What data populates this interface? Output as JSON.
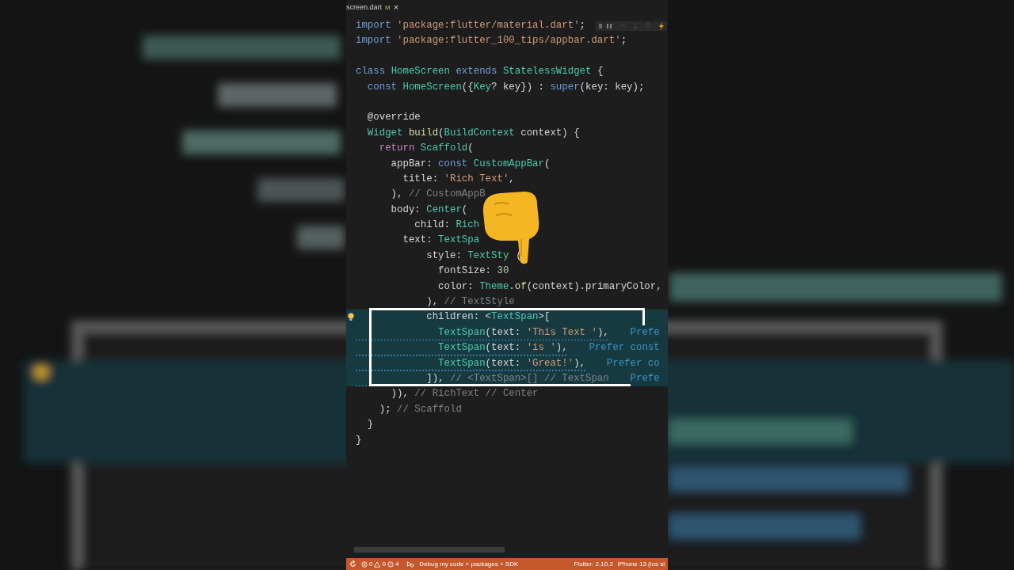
{
  "editor": {
    "tab": {
      "filename": "screen.dart",
      "badge": "M",
      "close": "×"
    },
    "lines": [
      {
        "kind": "code",
        "highlighted": false,
        "warning": false,
        "lightbulb": false,
        "tokens": [
          {
            "text": "import ",
            "kind": "kw"
          },
          {
            "text": "'package:flutter/material.dart'",
            "kind": "str"
          },
          {
            "text": ";",
            "kind": "plain"
          }
        ]
      },
      {
        "kind": "code",
        "highlighted": false,
        "warning": false,
        "lightbulb": false,
        "tokens": [
          {
            "text": "import ",
            "kind": "kw"
          },
          {
            "text": "'package:flutter_100_tips/appbar.dart'",
            "kind": "str"
          },
          {
            "text": ";",
            "kind": "plain"
          }
        ]
      },
      {
        "kind": "blank",
        "highlighted": false
      },
      {
        "kind": "code",
        "highlighted": false,
        "warning": false,
        "lightbulb": false,
        "tokens": [
          {
            "text": "class ",
            "kind": "kw"
          },
          {
            "text": "HomeScreen",
            "kind": "type"
          },
          {
            "text": " extends ",
            "kind": "kw"
          },
          {
            "text": "StatelessWidget",
            "kind": "type"
          },
          {
            "text": " {",
            "kind": "plain"
          }
        ]
      },
      {
        "kind": "code",
        "highlighted": false,
        "warning": false,
        "lightbulb": false,
        "tokens": [
          {
            "text": "  const ",
            "kind": "kw"
          },
          {
            "text": "HomeScreen",
            "kind": "type"
          },
          {
            "text": "({",
            "kind": "plain"
          },
          {
            "text": "Key",
            "kind": "type"
          },
          {
            "text": "? key}) : ",
            "kind": "plain"
          },
          {
            "text": "super",
            "kind": "kw"
          },
          {
            "text": "(key: key);",
            "kind": "plain"
          }
        ]
      },
      {
        "kind": "blank",
        "highlighted": false
      },
      {
        "kind": "code",
        "highlighted": false,
        "warning": false,
        "lightbulb": false,
        "tokens": [
          {
            "text": "  @override",
            "kind": "plain"
          }
        ]
      },
      {
        "kind": "code",
        "highlighted": false,
        "warning": false,
        "lightbulb": false,
        "tokens": [
          {
            "text": "  Widget ",
            "kind": "type"
          },
          {
            "text": "build",
            "kind": "fn"
          },
          {
            "text": "(",
            "kind": "plain"
          },
          {
            "text": "BuildContext",
            "kind": "type"
          },
          {
            "text": " context) {",
            "kind": "plain"
          }
        ]
      },
      {
        "kind": "code",
        "highlighted": false,
        "warning": false,
        "lightbulb": false,
        "tokens": [
          {
            "text": "    return ",
            "kind": "ctl"
          },
          {
            "text": "Scaffold",
            "kind": "type"
          },
          {
            "text": "(",
            "kind": "plain"
          }
        ]
      },
      {
        "kind": "code",
        "highlighted": false,
        "warning": false,
        "lightbulb": false,
        "tokens": [
          {
            "text": "      appBar: ",
            "kind": "plain"
          },
          {
            "text": "const ",
            "kind": "kw"
          },
          {
            "text": "CustomAppBar",
            "kind": "type"
          },
          {
            "text": "(",
            "kind": "plain"
          }
        ]
      },
      {
        "kind": "code",
        "highlighted": false,
        "warning": false,
        "lightbulb": false,
        "tokens": [
          {
            "text": "        title: ",
            "kind": "plain"
          },
          {
            "text": "'Rich Text'",
            "kind": "str"
          },
          {
            "text": ",",
            "kind": "plain"
          }
        ]
      },
      {
        "kind": "code",
        "highlighted": false,
        "warning": false,
        "lightbulb": false,
        "tokens": [
          {
            "text": "      ), ",
            "kind": "plain"
          },
          {
            "text": "// CustomAppB",
            "kind": "comment"
          }
        ]
      },
      {
        "kind": "code",
        "highlighted": false,
        "warning": false,
        "lightbulb": false,
        "tokens": [
          {
            "text": "      body: ",
            "kind": "plain"
          },
          {
            "text": "Center",
            "kind": "type"
          },
          {
            "text": "(",
            "kind": "plain"
          }
        ]
      },
      {
        "kind": "code",
        "highlighted": false,
        "warning": false,
        "lightbulb": false,
        "tokens": [
          {
            "text": "          child: ",
            "kind": "plain"
          },
          {
            "text": "Rich",
            "kind": "type"
          }
        ]
      },
      {
        "kind": "code",
        "highlighted": false,
        "warning": false,
        "lightbulb": false,
        "tokens": [
          {
            "text": "        text: ",
            "kind": "plain"
          },
          {
            "text": "TextSpa",
            "kind": "type"
          }
        ]
      },
      {
        "kind": "code",
        "highlighted": false,
        "warning": false,
        "lightbulb": false,
        "tokens": [
          {
            "text": "            style: ",
            "kind": "plain"
          },
          {
            "text": "TextSty",
            "kind": "type"
          },
          {
            "text": "(",
            "kind": "after-cover"
          }
        ]
      },
      {
        "kind": "code",
        "highlighted": false,
        "warning": false,
        "lightbulb": false,
        "tokens": [
          {
            "text": "              fontSize: ",
            "kind": "plain"
          },
          {
            "text": "30",
            "kind": "num"
          }
        ]
      },
      {
        "kind": "code",
        "highlighted": false,
        "warning": false,
        "lightbulb": false,
        "tokens": [
          {
            "text": "              color: ",
            "kind": "plain"
          },
          {
            "text": "Theme",
            "kind": "type"
          },
          {
            "text": ".",
            "kind": "plain"
          },
          {
            "text": "of",
            "kind": "fn"
          },
          {
            "text": "(context).primaryColor,",
            "kind": "plain"
          }
        ]
      },
      {
        "kind": "code",
        "highlighted": false,
        "warning": false,
        "lightbulb": false,
        "tokens": [
          {
            "text": "            ), ",
            "kind": "plain"
          },
          {
            "text": "// TextStyle",
            "kind": "comment"
          }
        ]
      },
      {
        "kind": "code",
        "highlighted": true,
        "warning": false,
        "lightbulb": true,
        "tokens": [
          {
            "text": "            children: <",
            "kind": "plain"
          },
          {
            "text": "TextSpan",
            "kind": "type"
          },
          {
            "text": ">[",
            "kind": "plain"
          }
        ]
      },
      {
        "kind": "code",
        "highlighted": true,
        "warning": true,
        "lightbulb": false,
        "hint": "Prefe",
        "tokens": [
          {
            "text": "              TextSpan",
            "kind": "type"
          },
          {
            "text": "(text: ",
            "kind": "plain"
          },
          {
            "text": "'This Text '",
            "kind": "str"
          },
          {
            "text": "),",
            "kind": "plain"
          }
        ]
      },
      {
        "kind": "code",
        "highlighted": true,
        "warning": true,
        "lightbulb": false,
        "hint": "Prefer const",
        "tokens": [
          {
            "text": "              TextSpan",
            "kind": "type"
          },
          {
            "text": "(text: ",
            "kind": "plain"
          },
          {
            "text": "'is '",
            "kind": "str"
          },
          {
            "text": "),",
            "kind": "plain"
          }
        ]
      },
      {
        "kind": "code",
        "highlighted": true,
        "warning": true,
        "lightbulb": false,
        "hint": "Prefer co",
        "tokens": [
          {
            "text": "              TextSpan",
            "kind": "type"
          },
          {
            "text": "(text: ",
            "kind": "plain"
          },
          {
            "text": "'Great!'",
            "kind": "str"
          },
          {
            "text": "),",
            "kind": "plain"
          }
        ]
      },
      {
        "kind": "code",
        "highlighted": true,
        "warning": true,
        "lightbulb": false,
        "hint": "Prefe",
        "tokens": [
          {
            "text": "            ]), ",
            "kind": "plain"
          },
          {
            "text": "// <TextSpan>[] // TextSpan",
            "kind": "comment"
          }
        ]
      },
      {
        "kind": "code",
        "highlighted": false,
        "warning": false,
        "lightbulb": false,
        "tokens": [
          {
            "text": "      )), ",
            "kind": "plain"
          },
          {
            "text": "// RichText // Center",
            "kind": "comment"
          }
        ]
      },
      {
        "kind": "code",
        "highlighted": false,
        "warning": false,
        "lightbulb": false,
        "tokens": [
          {
            "text": "    ); ",
            "kind": "plain"
          },
          {
            "text": "// Scaffold",
            "kind": "comment"
          }
        ]
      },
      {
        "kind": "code",
        "highlighted": false,
        "warning": false,
        "lightbulb": false,
        "tokens": [
          {
            "text": "  }",
            "kind": "plain"
          }
        ]
      },
      {
        "kind": "code",
        "highlighted": false,
        "warning": false,
        "lightbulb": false,
        "tokens": [
          {
            "text": "}",
            "kind": "plain"
          }
        ]
      }
    ]
  },
  "status_bar": {
    "errors": "0",
    "warnings": "0",
    "infos": "4",
    "debug_config": "Debug my code + packages + SDK",
    "flutter_version": "Flutter: 2.10.2",
    "device": "iPhone 13 (ios si"
  }
}
